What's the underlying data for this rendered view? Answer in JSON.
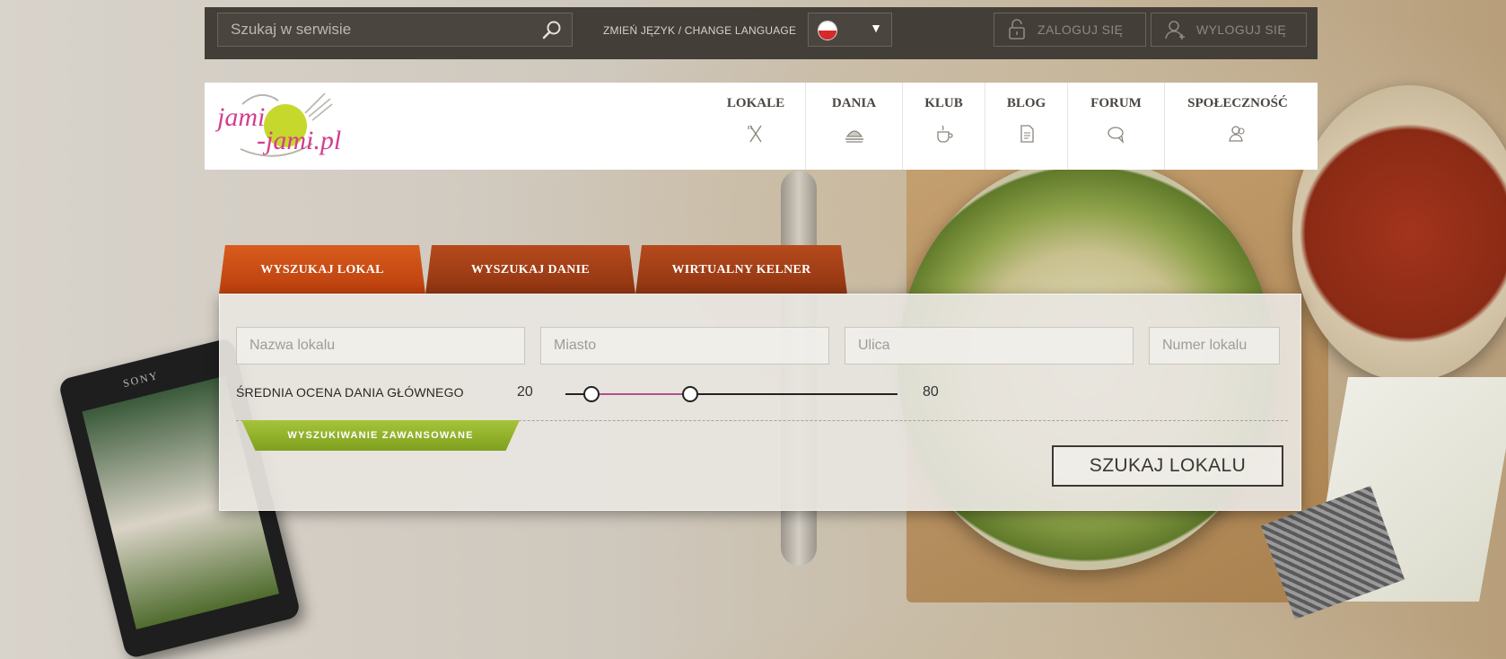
{
  "topbar": {
    "search_placeholder": "Szukaj w serwisie",
    "language_label": "ZMIEŃ JĘZYK / CHANGE LANGUAGE",
    "login_label": "ZALOGUJ SIĘ",
    "logout_label": "WYLOGUJ SIĘ"
  },
  "logo": {
    "text": "jami-jami.pl"
  },
  "nav": [
    {
      "label": "LOKALE",
      "icon": "fork-knife-icon"
    },
    {
      "label": "DANIA",
      "icon": "dish-icon"
    },
    {
      "label": "KLUB",
      "icon": "cup-icon"
    },
    {
      "label": "BLOG",
      "icon": "document-icon"
    },
    {
      "label": "FORUM",
      "icon": "speech-bubble-icon"
    },
    {
      "label": "SPOŁECZNOŚĆ",
      "icon": "users-icon"
    }
  ],
  "search_widget": {
    "tabs": [
      "WYSZUKAJ LOKAL",
      "WYSZUKAJ DANIE",
      "WIRTUALNY KELNER"
    ],
    "active_tab": 0,
    "fields": {
      "name_placeholder": "Nazwa lokalu",
      "city_placeholder": "Miasto",
      "street_placeholder": "Ulica",
      "number_placeholder": "Numer lokalu"
    },
    "rating": {
      "label": "ŚREDNIA OCENA DANIA GŁÓWNEGO",
      "min_label": "20",
      "max_label": "80"
    },
    "advanced_label": "WYSZUKIWANIE ZAWANSOWANE",
    "submit_label": "SZUKAJ LOKALU"
  },
  "background": {
    "phone_brand": "SONY"
  },
  "colors": {
    "topbar": "#433e38",
    "tab_active": "#d95c1d",
    "advanced_green": "#8fb02a",
    "slider_range": "#b04f8f"
  }
}
